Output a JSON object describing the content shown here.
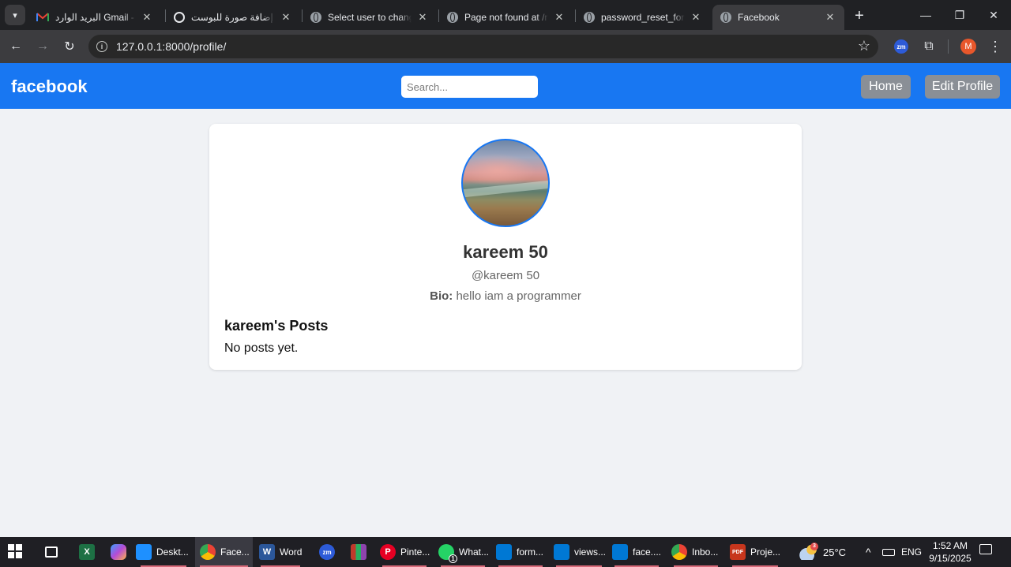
{
  "browser": {
    "tabs": [
      {
        "title": "البريد الوارد Gmail - m",
        "favicon": "gmail-icon"
      },
      {
        "title": "إضافة صورة للبوست",
        "favicon": "openai-icon"
      },
      {
        "title": "Select user to change",
        "favicon": "globe-icon"
      },
      {
        "title": "Page not found at /re",
        "favicon": "globe-icon"
      },
      {
        "title": "password_reset_form",
        "favicon": "globe-icon"
      },
      {
        "title": "Facebook",
        "favicon": "globe-icon",
        "active": true
      }
    ],
    "url": "127.0.0.1:8000/profile/",
    "profile_initial": "M",
    "zm_extension_label": "zm"
  },
  "navbar": {
    "logo": "facebook",
    "search_placeholder": "Search...",
    "home_label": "Home",
    "edit_profile_label": "Edit Profile"
  },
  "profile": {
    "name": "kareem 50",
    "handle": "@kareem 50",
    "bio_label": "Bio:",
    "bio_text": "hello iam a programmer",
    "posts_heading": "kareem's Posts",
    "no_posts": "No posts yet."
  },
  "taskbar": {
    "items": [
      {
        "label": "",
        "icon": "task-view-icon"
      },
      {
        "label": "",
        "icon": "excel-icon"
      },
      {
        "label": "",
        "icon": "copilot-icon"
      },
      {
        "label": "Deskt...",
        "icon": "desktop-icon"
      },
      {
        "label": "Face...",
        "icon": "chrome-icon"
      },
      {
        "label": "Word",
        "icon": "word-icon"
      },
      {
        "label": "",
        "icon": "zoom-icon"
      },
      {
        "label": "",
        "icon": "winrar-icon"
      },
      {
        "label": "Pinte...",
        "icon": "pinterest-icon"
      },
      {
        "label": "What...",
        "icon": "whatsapp-icon"
      },
      {
        "label": "form...",
        "icon": "vscode-icon"
      },
      {
        "label": "views...",
        "icon": "vscode-icon"
      },
      {
        "label": "face....",
        "icon": "vscode-icon"
      },
      {
        "label": "Inbo...",
        "icon": "chrome-icon"
      },
      {
        "label": "Proje...",
        "icon": "pdf-icon"
      }
    ],
    "weather_temp": "25°C",
    "weather_badge": "3",
    "whatsapp_badge": "1",
    "language": "ENG",
    "time": "1:52 AM",
    "date": "9/15/2025"
  }
}
